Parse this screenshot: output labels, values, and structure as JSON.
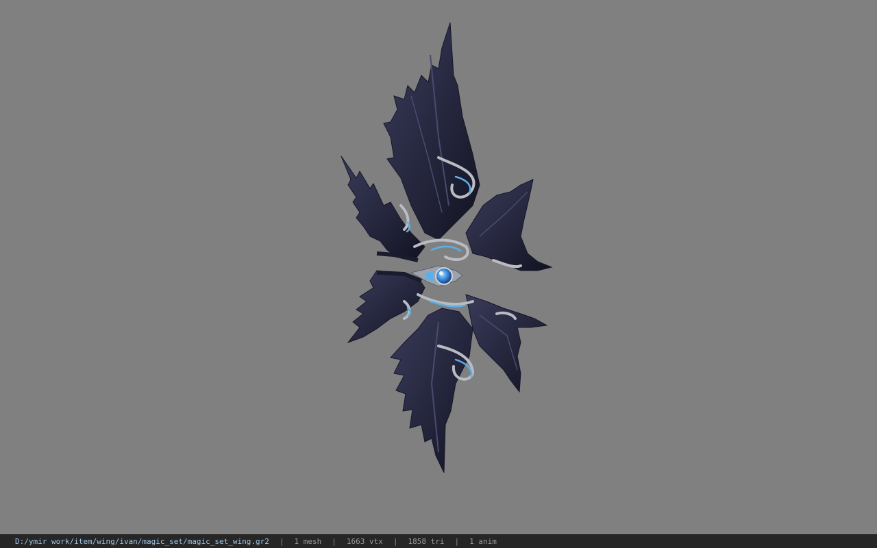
{
  "viewer": {
    "background_color": "#808080",
    "model": {
      "icon": "wing-model-icon",
      "feather_color": "#23243a",
      "trim_color": "#b9bcc3",
      "gem_color": "#3d8fe0"
    }
  },
  "status_bar": {
    "file_path": "D:/ymir work/item/wing/ivan/magic_set/magic_set_wing.gr2",
    "separator": "|",
    "mesh_count": "1 mesh",
    "vertex_count": "1663 vtx",
    "triangle_count": "1858 tri",
    "anim_count": "1 anim"
  }
}
